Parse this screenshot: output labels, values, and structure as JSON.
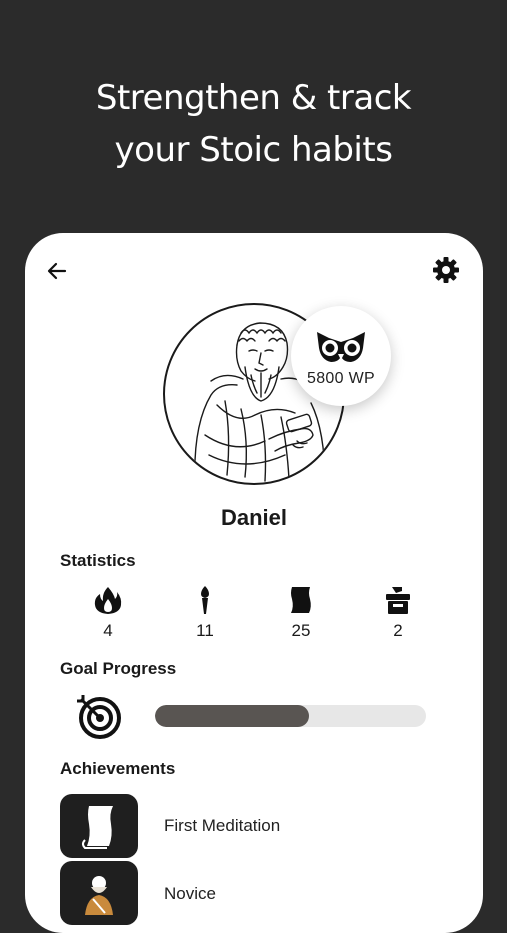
{
  "headline": {
    "line1": "Strengthen & track",
    "line2": "your Stoic habits"
  },
  "profile": {
    "name": "Daniel",
    "wisdom_points": "5800 WP"
  },
  "statistics": {
    "title": "Statistics",
    "items": [
      {
        "icon": "flame-icon",
        "value": "4"
      },
      {
        "icon": "torch-icon",
        "value": "11"
      },
      {
        "icon": "scroll-icon",
        "value": "25"
      },
      {
        "icon": "box-icon",
        "value": "2"
      }
    ]
  },
  "goal": {
    "title": "Goal Progress",
    "progress": 0.57
  },
  "achievements": {
    "title": "Achievements",
    "items": [
      {
        "icon": "scroll-icon",
        "label": "First Meditation"
      },
      {
        "icon": "philosopher-icon",
        "label": "Novice"
      }
    ]
  },
  "colors": {
    "background": "#2b2b2b",
    "card": "#ffffff",
    "progress_fill": "#595552",
    "progress_track": "#e7e7e7",
    "tile": "#1f1f1f"
  }
}
